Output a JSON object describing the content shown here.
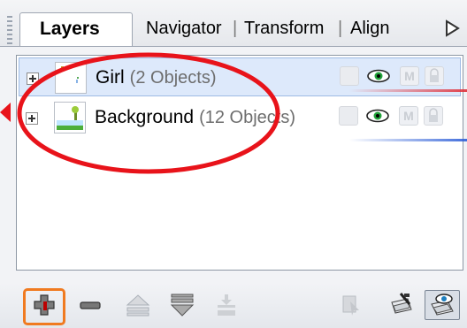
{
  "tabs": [
    {
      "label": "Layers",
      "active": true
    },
    {
      "label": "Navigator",
      "active": false
    },
    {
      "label": "Transform",
      "active": false
    },
    {
      "label": "Align",
      "active": false
    }
  ],
  "tab_separator": "|",
  "layers": [
    {
      "name": "Girl",
      "count": "(2 Objects)",
      "selected": true,
      "underline_color": "#e0303a"
    },
    {
      "name": "Background",
      "count": "(12 Objects)",
      "selected": false,
      "underline_color": "#2e5fd8"
    }
  ],
  "layer_states": {
    "lock_tooltip_icon": "lock-icon",
    "visibility_icon": "eye-icon",
    "master_icon": "m-icon",
    "m_label": "M"
  },
  "toolbar": {
    "buttons": [
      "new-layer",
      "delete-layer",
      "move-layer-up",
      "move-layer-down",
      "merge-layer",
      "locate-object",
      "edit-all-layers",
      "show-all-layers"
    ]
  },
  "annotation": {
    "highlight_color": "#f07a20",
    "ellipse_color": "#e8131a"
  }
}
